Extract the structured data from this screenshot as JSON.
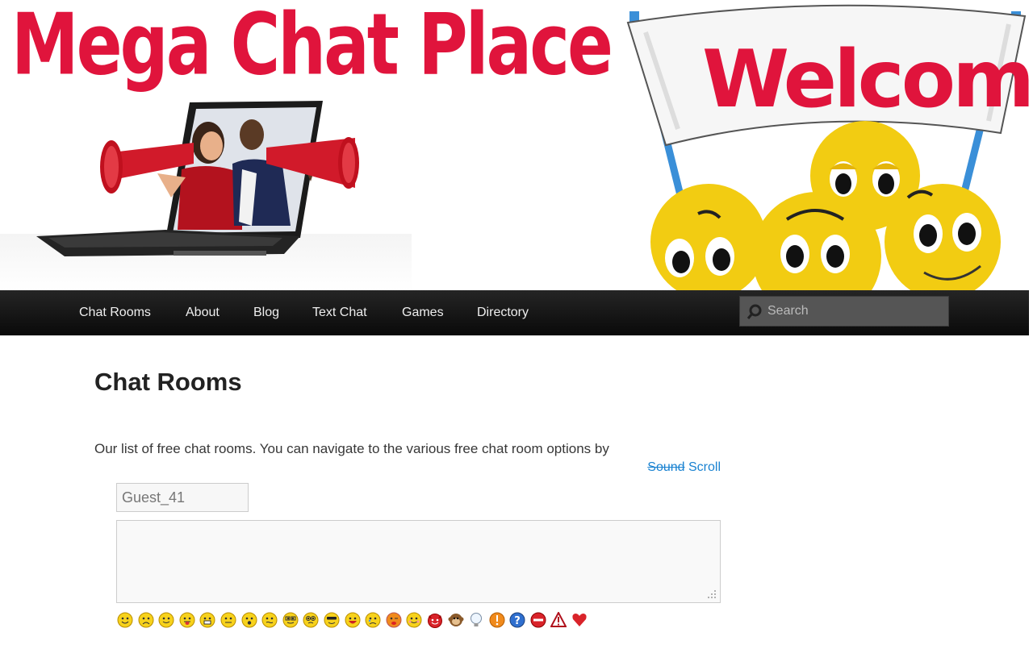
{
  "header": {
    "site_title": "Mega Chat Place",
    "banner_text": "Welcome"
  },
  "nav": {
    "items": [
      {
        "label": "Chat Rooms"
      },
      {
        "label": "About"
      },
      {
        "label": "Blog"
      },
      {
        "label": "Text Chat"
      },
      {
        "label": "Games"
      },
      {
        "label": "Directory"
      }
    ],
    "search": {
      "placeholder": "Search"
    }
  },
  "main": {
    "page_title": "Chat Rooms",
    "intro_text": "Our list of free chat rooms. You can navigate to the various free chat room options by",
    "chat": {
      "sound_label": "Sound",
      "scroll_label": "Scroll",
      "username_value": "Guest_41",
      "message_value": ""
    }
  },
  "emoticons": [
    "smile-icon",
    "frown-icon",
    "happy-icon",
    "tongue-icon",
    "grin-icon",
    "neutral-icon",
    "shocked-icon",
    "confused-icon",
    "nerd-icon",
    "dizzy-icon",
    "cool-icon",
    "laugh-icon",
    "cry-icon",
    "wink-tongue-icon",
    "blush-icon",
    "devil-icon",
    "monkey-icon",
    "lightbulb-icon",
    "exclamation-icon",
    "question-icon",
    "no-entry-icon",
    "warning-icon",
    "heart-icon"
  ],
  "colors": {
    "brand_red": "#e0143c",
    "nav_bg": "#1a1a1a",
    "link_blue": "#1982d1",
    "smiley_yellow": "#f7d21c"
  }
}
